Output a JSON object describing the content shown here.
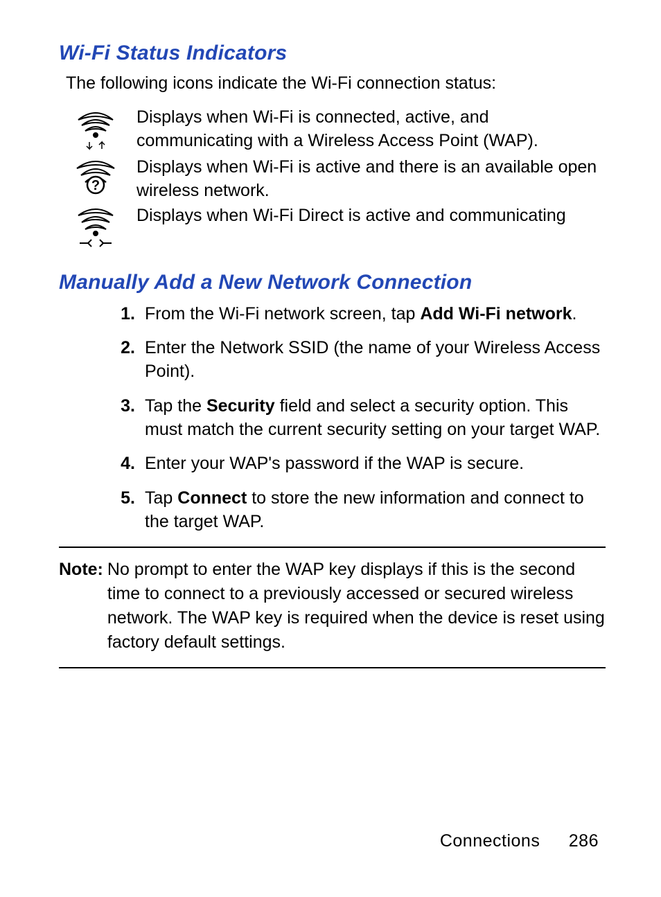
{
  "section1": {
    "heading": "Wi-Fi Status Indicators",
    "intro": "The following icons indicate the Wi-Fi connection status:",
    "items": [
      {
        "icon": "wifi-active-icon",
        "desc": " Displays when Wi-Fi is connected, active, and communicating with a Wireless Access Point (WAP)."
      },
      {
        "icon": "wifi-open-icon",
        "desc": "Displays when Wi-Fi is active and there is an available open wireless network."
      },
      {
        "icon": "wifi-direct-icon",
        "desc": "Displays when Wi-Fi Direct is active and communicating"
      }
    ]
  },
  "section2": {
    "heading": "Manually Add a New Network Connection",
    "steps": [
      {
        "num": "1.",
        "pre": "From the Wi-Fi network screen, tap ",
        "bold": "Add Wi-Fi network",
        "post": "."
      },
      {
        "num": "2.",
        "pre": "Enter the Network SSID (the name of your Wireless Access Point).",
        "bold": "",
        "post": ""
      },
      {
        "num": "3.",
        "pre": "Tap the ",
        "bold": "Security",
        "post": " field and select a security option. This must match the current security setting on your target WAP."
      },
      {
        "num": "4.",
        "pre": "Enter your WAP's password if the WAP is secure.",
        "bold": "",
        "post": ""
      },
      {
        "num": "5.",
        "pre": "Tap ",
        "bold": "Connect",
        "post": " to store the new information and connect to the target WAP."
      }
    ]
  },
  "note": {
    "label": "Note:",
    "text": " No prompt to enter the WAP key displays if this is the second time to connect to a previously accessed or secured wireless network. The WAP key is required when the device is reset using factory default settings."
  },
  "footer": {
    "section": "Connections",
    "page": "286"
  }
}
